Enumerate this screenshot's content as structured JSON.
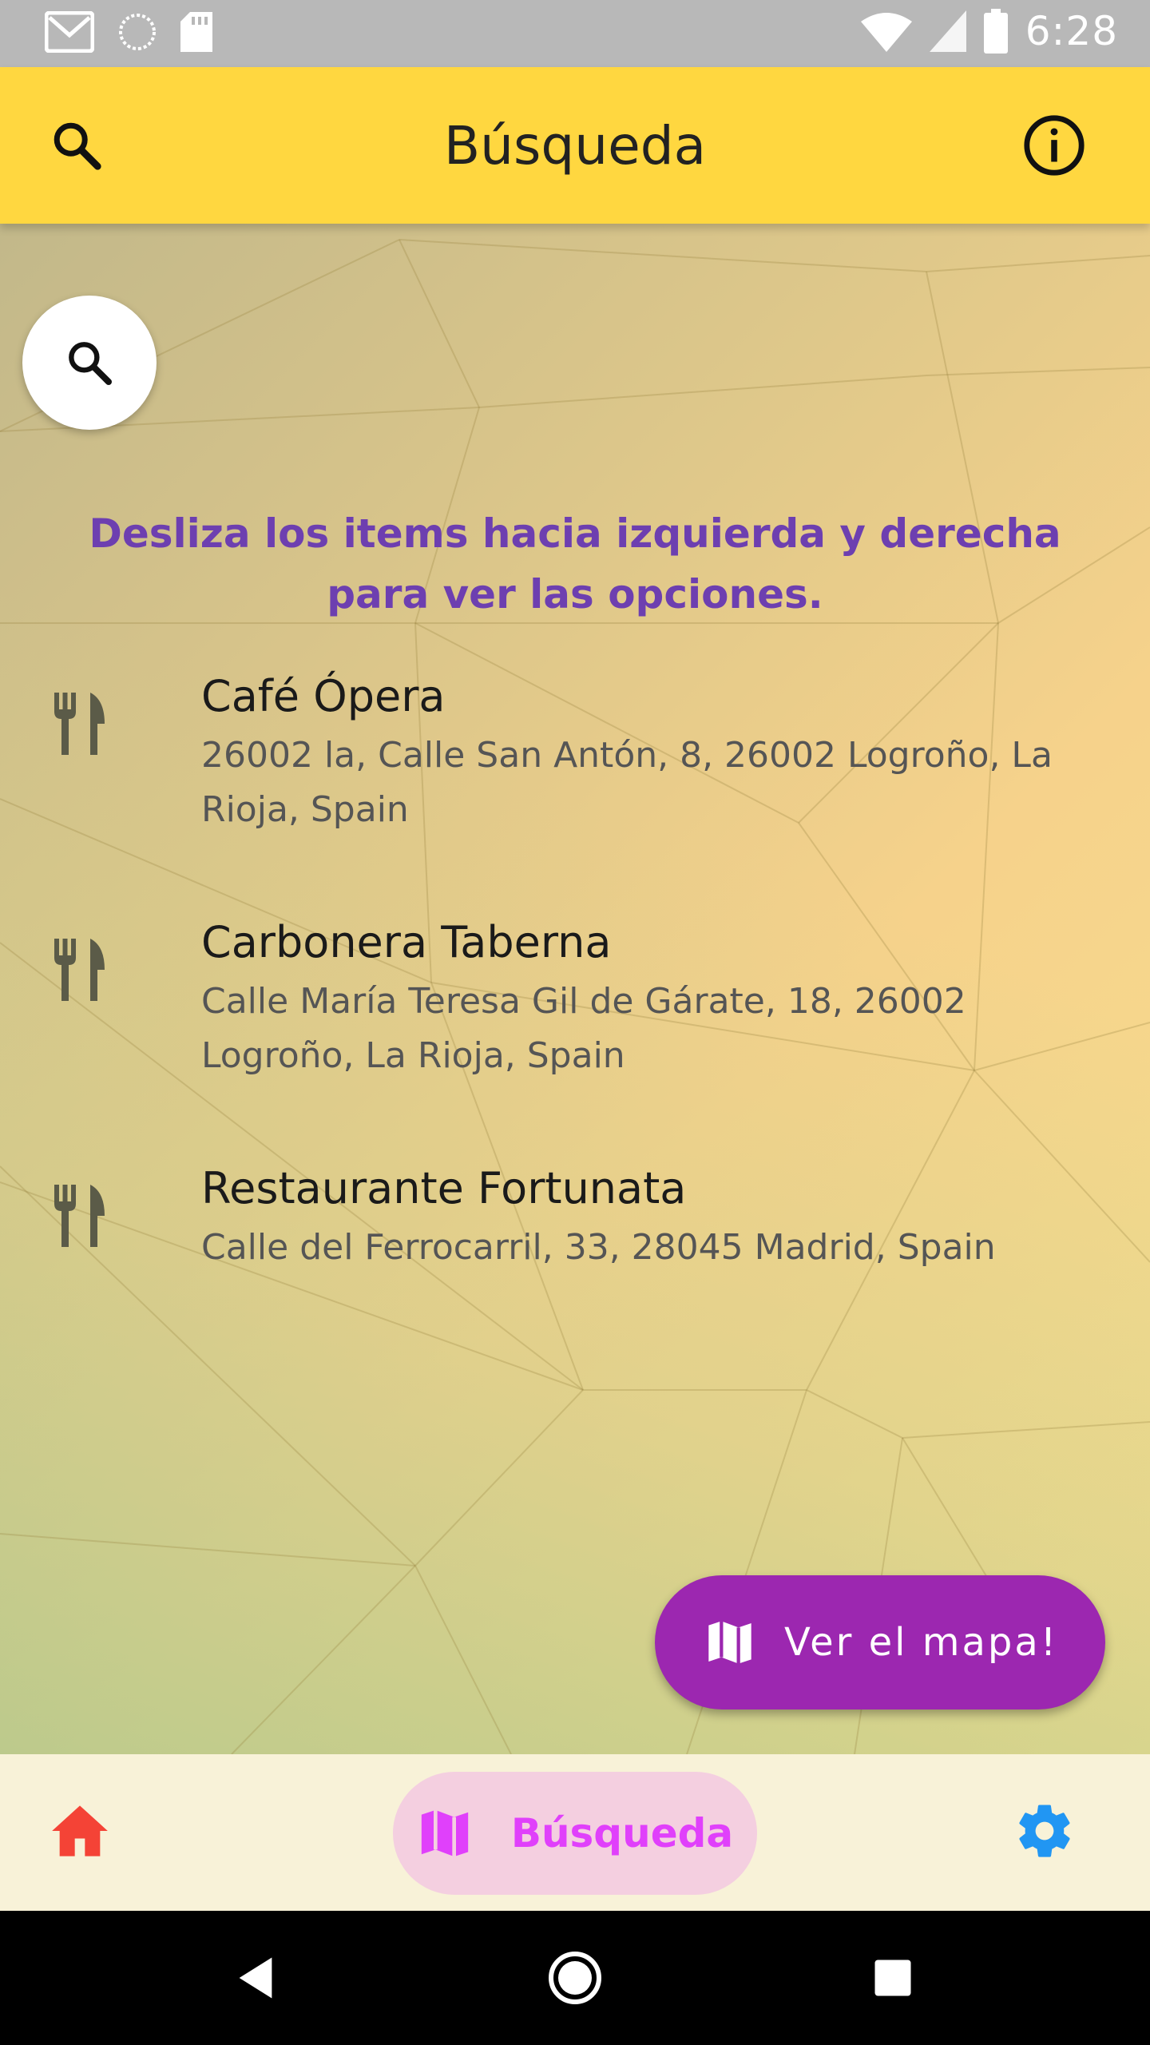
{
  "status_bar": {
    "time": "6:28",
    "icons": [
      "gmail-icon",
      "sync-icon",
      "sd-card-icon",
      "wifi-icon",
      "cell-signal-icon",
      "battery-icon"
    ]
  },
  "app_bar": {
    "title": "Búsqueda",
    "left_icon": "search-icon",
    "right_icon": "info-icon",
    "color": "#ffd740"
  },
  "content": {
    "search_fab_icon": "search-icon",
    "hint": "Desliza los items hacia izquierda y derecha para ver las opciones.",
    "hint_color": "#6d3fb0",
    "results": [
      {
        "icon": "restaurant-icon",
        "name": "Café Ópera",
        "address": "26002 la, Calle San Antón, 8, 26002 Logroño, La Rioja, Spain"
      },
      {
        "icon": "restaurant-icon",
        "name": "Carbonera Taberna",
        "address": "Calle María Teresa Gil de Gárate, 18, 26002 Logroño, La Rioja, Spain"
      },
      {
        "icon": "restaurant-icon",
        "name": "Restaurante Fortunata",
        "address": "Calle del Ferrocarril, 33, 28045 Madrid, Spain"
      }
    ],
    "map_button": {
      "icon": "map-icon",
      "label": "Ver el mapa!",
      "color": "#9c27b0"
    }
  },
  "bottom_nav": {
    "items": [
      {
        "icon": "home-icon",
        "label": "",
        "color": "#f44336"
      },
      {
        "icon": "map-icon",
        "label": "Búsqueda",
        "color": "#e040fb",
        "selected": true
      },
      {
        "icon": "settings-icon",
        "label": "",
        "color": "#2196f3"
      }
    ]
  },
  "system_nav": {
    "buttons": [
      "back-icon",
      "home-circle-icon",
      "recents-icon"
    ]
  }
}
